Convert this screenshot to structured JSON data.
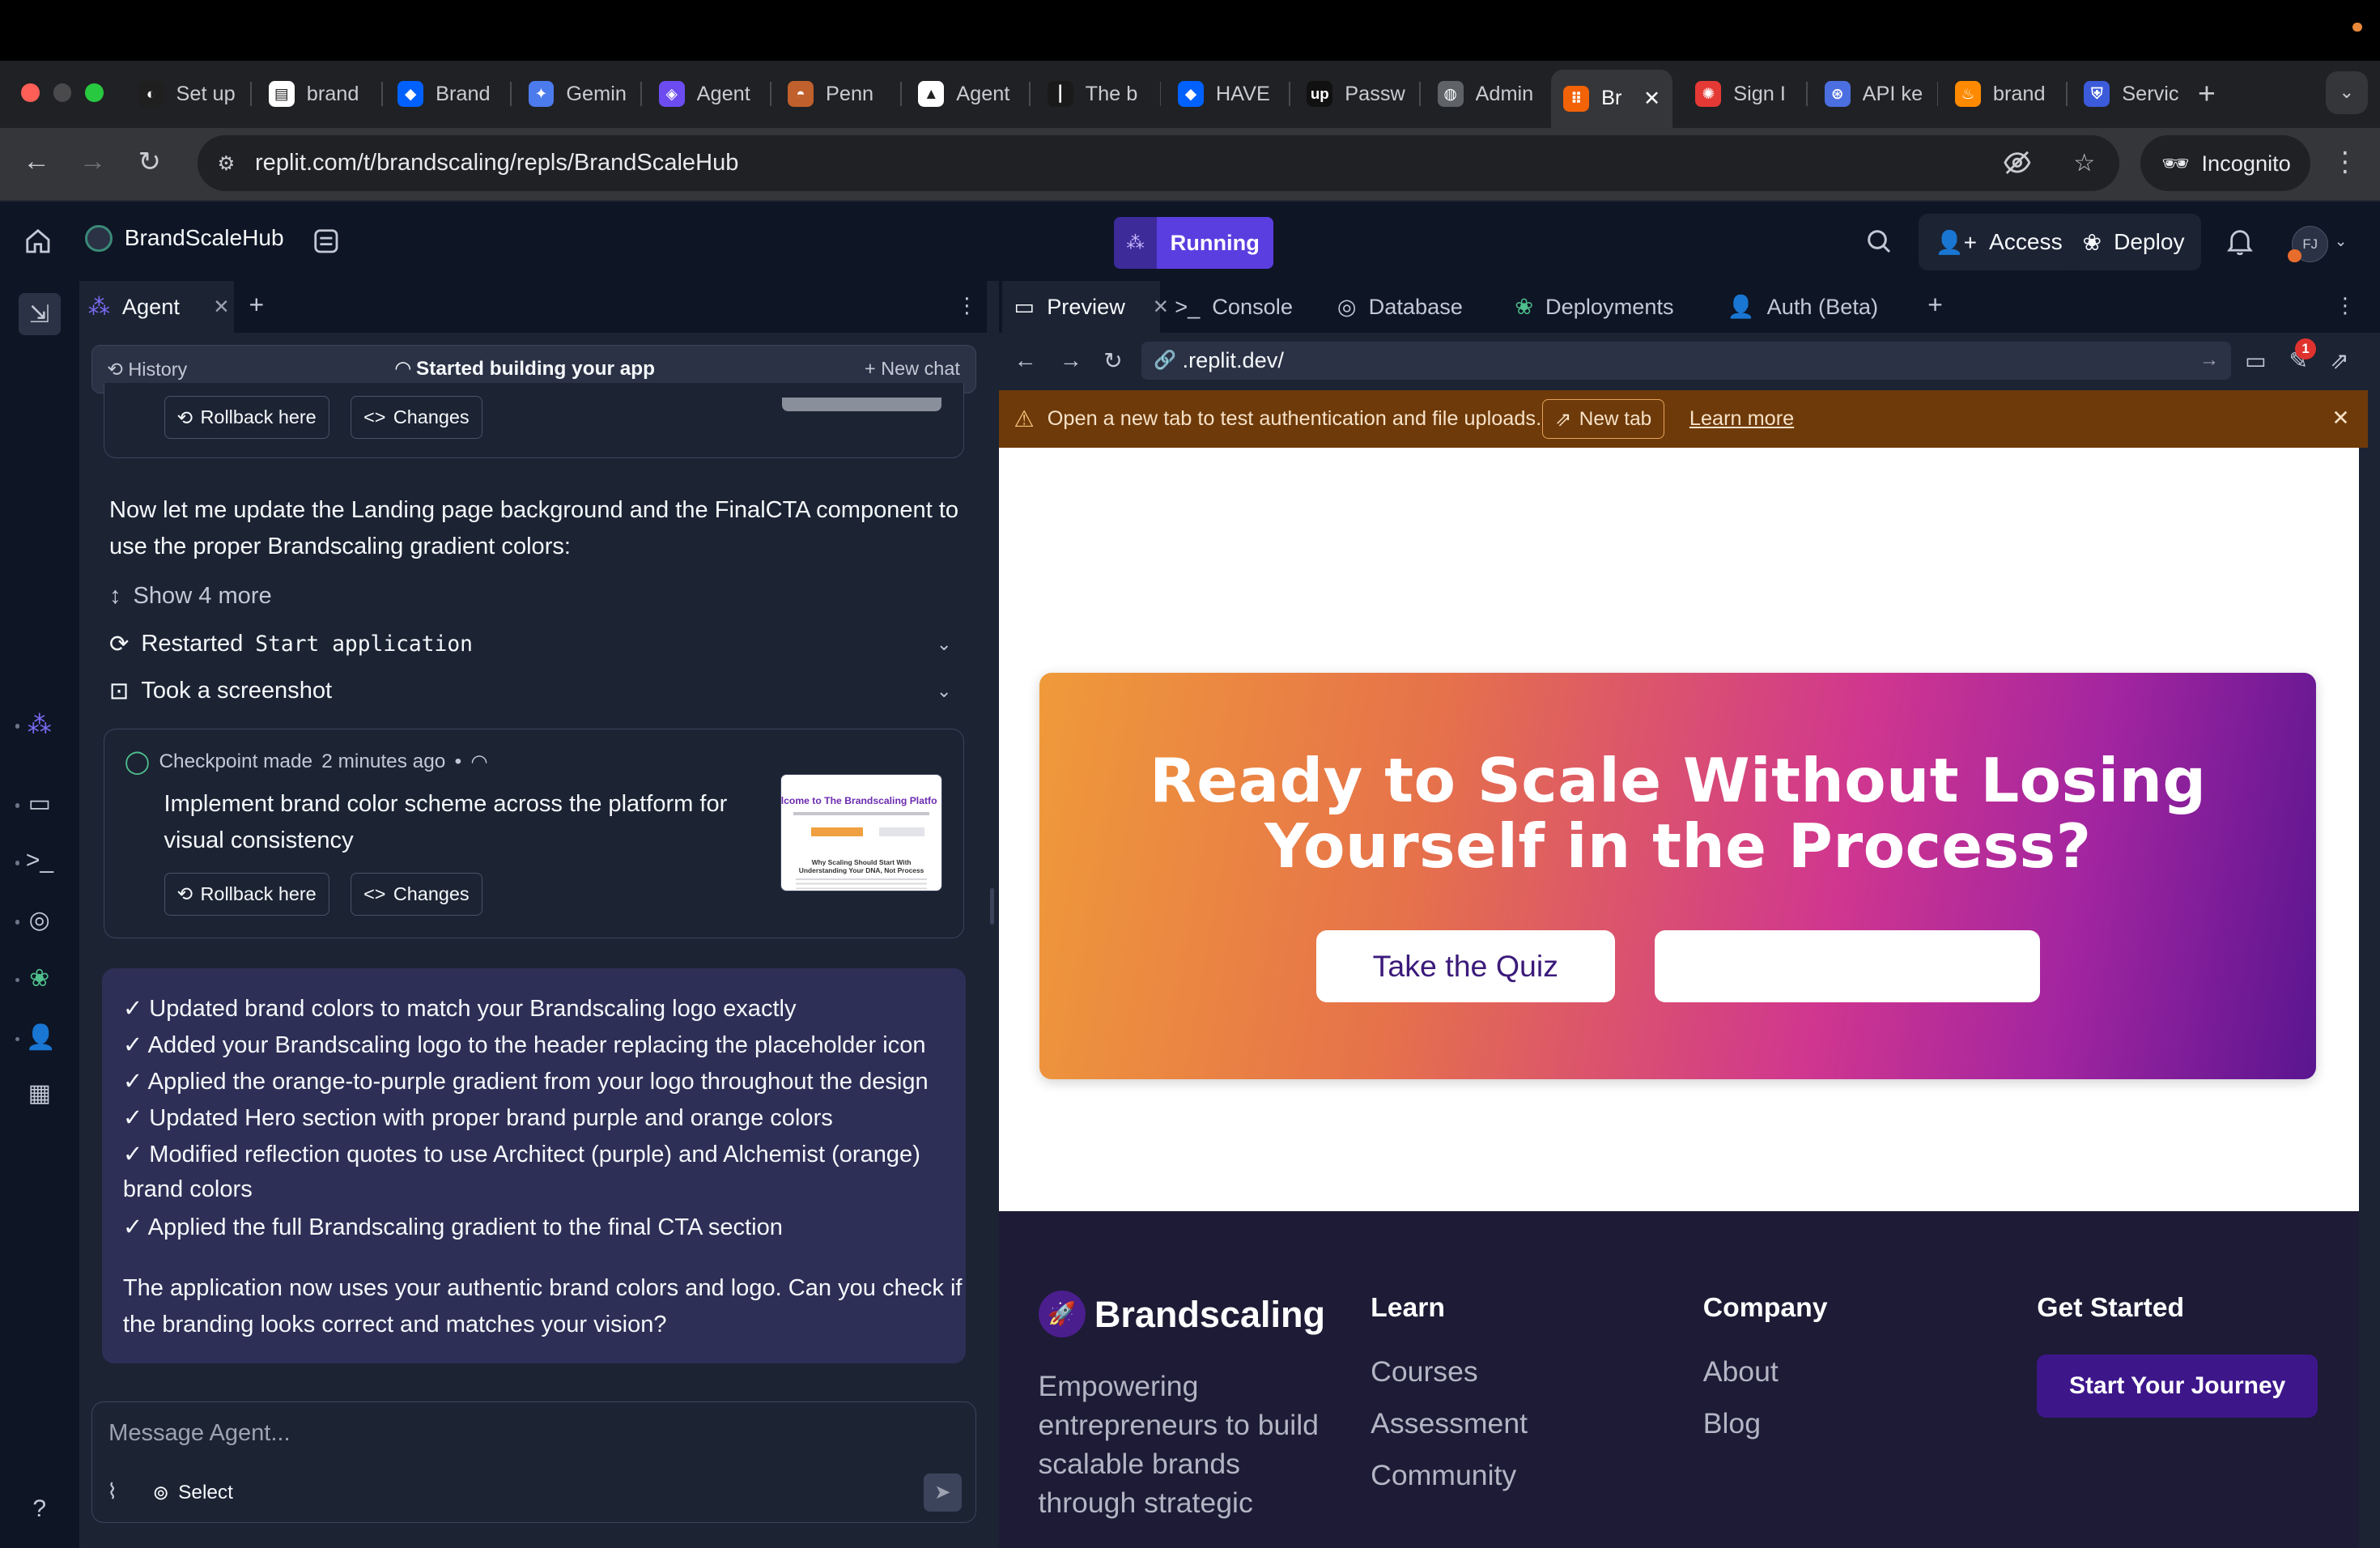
{
  "browser": {
    "tabs": [
      {
        "label": "Set up",
        "icon": "set-up-tab-icon",
        "color": "#1f1f1f"
      },
      {
        "label": "brand",
        "icon": "brand-doc-icon",
        "color": "#ffffff"
      },
      {
        "label": "Brand",
        "icon": "dropbox-icon",
        "color": "#0061fe"
      },
      {
        "label": "Gemin",
        "icon": "gemini-icon",
        "color": "#4b7bec"
      },
      {
        "label": "Agent",
        "icon": "agent-app-icon",
        "color": "#6c4cf1"
      },
      {
        "label": "Penn",
        "icon": "penn-icon",
        "color": "#c0602c"
      },
      {
        "label": "Agent",
        "icon": "agent-triangle-icon",
        "color": "#ffffff"
      },
      {
        "label": "The b",
        "icon": "the-b-icon",
        "color": "#1a1a1a"
      },
      {
        "label": "HAVE",
        "icon": "dropbox-icon",
        "color": "#0061fe"
      },
      {
        "label": "Passw",
        "icon": "upwork-icon",
        "color": "#111111"
      },
      {
        "label": "Admin",
        "icon": "globe-icon",
        "color": "#5f6368"
      },
      {
        "label": "Br",
        "icon": "replit-icon",
        "color": "#f26207",
        "active": true
      },
      {
        "label": "Sign I",
        "icon": "sign-in-icon",
        "color": "#e53935"
      },
      {
        "label": "API ke",
        "icon": "openai-icon",
        "color": "#4b6fe0"
      },
      {
        "label": "brand",
        "icon": "firebase-icon",
        "color": "#ff8a00"
      },
      {
        "label": "Servic",
        "icon": "shield-app-icon",
        "color": "#3b5bdb"
      }
    ],
    "url": "replit.com/t/brandscaling/repls/BrandScaleHub",
    "incognito_label": "Incognito"
  },
  "replit": {
    "project_name": "BrandScaleHub",
    "run_status": "Running",
    "access_label": "Access",
    "deploy_label": "Deploy",
    "avatar_initials": "FJ"
  },
  "agent": {
    "tab_label": "Agent",
    "history_label": "History",
    "status_label": "Started building your app",
    "new_chat_label": "New chat",
    "rollback_label": "Rollback here",
    "changes_label": "Changes",
    "message": "Now let me update the Landing page background and the FinalCTA component to use the proper Brandscaling gradient colors:",
    "show_more": "Show 4 more",
    "restarted_prefix": "Restarted",
    "restarted_code": "Start application",
    "screenshot_label": "Took a screenshot",
    "checkpoint_label": "Checkpoint made",
    "checkpoint_time": "2 minutes ago",
    "checkpoint_desc": "Implement brand color scheme across the platform for visual consistency",
    "thumb_title": "lcome to The Brandscaling Platfo",
    "thumb_sub": "Why Scaling Should Start With Understanding Your DNA, Not Process",
    "summary_items": [
      "✓ Updated brand colors to match your Brandscaling logo exactly",
      "✓ Added your Brandscaling logo to the header replacing the placeholder icon",
      "✓ Applied the orange-to-purple gradient from your logo throughout the design",
      "✓ Updated Hero section with proper brand purple and orange colors",
      "✓ Modified reflection quotes to use Architect (purple) and Alchemist (orange)",
      "brand colors",
      "✓ Applied the full Brandscaling gradient to the final CTA section"
    ],
    "summary_closing_1": "The application now uses your authentic brand colors and logo. Can you check if",
    "summary_closing_2": "the branding looks correct and matches your vision?",
    "composer_placeholder": "Message Agent...",
    "select_label": "Select"
  },
  "workspace": {
    "tabs": [
      {
        "label": "Preview",
        "icon": "monitor-icon"
      },
      {
        "label": "Console",
        "icon": "terminal-icon"
      },
      {
        "label": "Database",
        "icon": "database-icon"
      },
      {
        "label": "Deployments",
        "icon": "deployments-icon"
      },
      {
        "label": "Auth (Beta)",
        "icon": "auth-user-icon"
      }
    ],
    "preview_url": ".replit.dev/",
    "notification_count": "1",
    "banner_text": "Open a new tab to test authentication and file uploads.",
    "banner_button": "New tab",
    "banner_link": "Learn more"
  },
  "site": {
    "cta_title_line1": "Ready to Scale Without Losing",
    "cta_title_line2": "Yourself in the Process?",
    "cta_button": "Take the Quiz",
    "cta_gradient_start": "#ef9a3a",
    "cta_gradient_end": "#5a1590",
    "footer": {
      "brand": "Brandscaling",
      "tagline": "Empowering entrepreneurs to build scalable brands through strategic",
      "learn_heading": "Learn",
      "learn_links": [
        "Courses",
        "Assessment",
        "Community"
      ],
      "company_heading": "Company",
      "company_links": [
        "About",
        "Blog"
      ],
      "get_started_heading": "Get Started",
      "get_started_button": "Start Your Journey"
    }
  }
}
